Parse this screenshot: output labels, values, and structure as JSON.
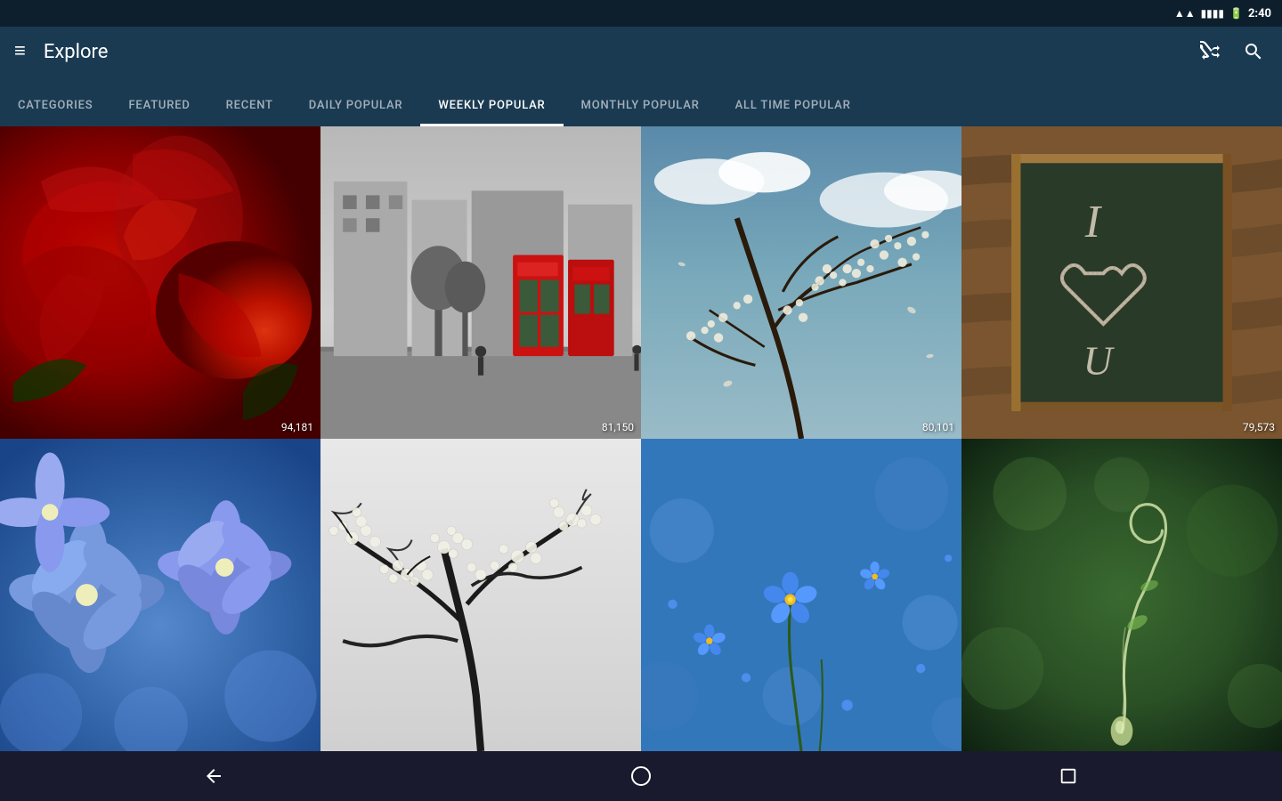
{
  "statusBar": {
    "time": "2:40",
    "batteryIcon": "🔋",
    "wifiIcon": "▲"
  },
  "topBar": {
    "menuIcon": "≡",
    "title": "Explore",
    "shuffleIcon": "shuffle",
    "searchIcon": "search"
  },
  "tabs": [
    {
      "id": "categories",
      "label": "CATEGORIES",
      "active": false
    },
    {
      "id": "featured",
      "label": "FEATURED",
      "active": false
    },
    {
      "id": "recent",
      "label": "RECENT",
      "active": false
    },
    {
      "id": "daily-popular",
      "label": "DAILY POPULAR",
      "active": false
    },
    {
      "id": "weekly-popular",
      "label": "WEEKLY POPULAR",
      "active": true
    },
    {
      "id": "monthly-popular",
      "label": "MONTHLY POPULAR",
      "active": false
    },
    {
      "id": "all-time-popular",
      "label": "ALL TIME POPULAR",
      "active": false
    }
  ],
  "images": [
    {
      "id": "roses",
      "views": "94,181",
      "type": "roses"
    },
    {
      "id": "london",
      "views": "81,150",
      "type": "london"
    },
    {
      "id": "cherry",
      "views": "80,101",
      "type": "cherry"
    },
    {
      "id": "chalk",
      "views": "79,573",
      "type": "chalk"
    },
    {
      "id": "blue-flowers",
      "views": "",
      "type": "blue-flowers"
    },
    {
      "id": "bw-trees",
      "views": "",
      "type": "bw-trees"
    },
    {
      "id": "forget",
      "views": "",
      "type": "forget"
    },
    {
      "id": "spiral",
      "views": "",
      "type": "spiral"
    }
  ],
  "bottomNav": {
    "backIcon": "◁",
    "homeIcon": "○",
    "recentIcon": "□"
  }
}
